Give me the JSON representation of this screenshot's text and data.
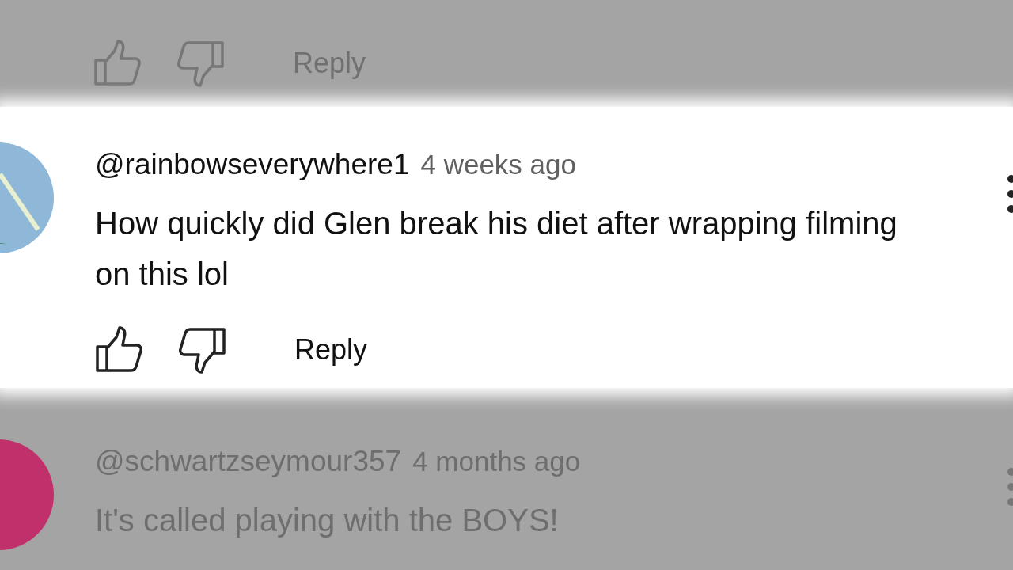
{
  "top_actions": {
    "reply": "Reply",
    "highlighted": false
  },
  "comments": [
    {
      "author": "@rainbowseverywhere1",
      "time": "4 weeks ago",
      "text": "How quickly did Glen break his diet after wrapping filming on this lol",
      "color": "#8fb8d8",
      "highlighted": true,
      "reply": "Reply"
    },
    {
      "author": "@schwartzseymour357",
      "time": "4 months ago",
      "text": "It's called playing with the BOYS!",
      "color": "#c0306a",
      "highlighted": false
    }
  ]
}
